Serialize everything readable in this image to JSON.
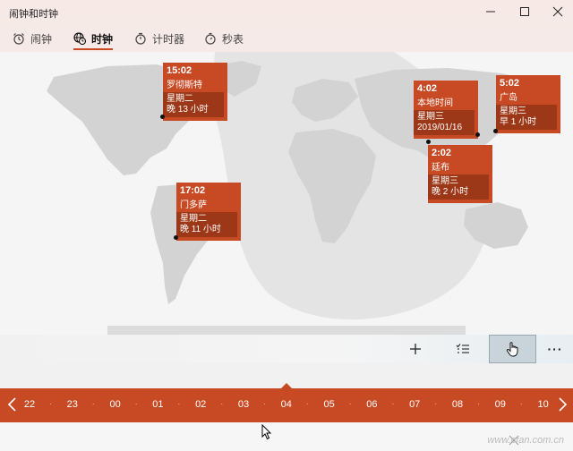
{
  "window": {
    "title": "闹钟和时钟"
  },
  "tabs": [
    {
      "label": "闹钟",
      "icon": "alarm-clock-icon"
    },
    {
      "label": "时钟",
      "icon": "globe-clock-icon",
      "active": true
    },
    {
      "label": "计时器",
      "icon": "timer-icon"
    },
    {
      "label": "秒表",
      "icon": "stopwatch-icon"
    }
  ],
  "clocks": [
    {
      "time": "15:02",
      "city": "罗彻斯特",
      "day": "星期二",
      "offset": "晚 13 小时"
    },
    {
      "time": "17:02",
      "city": "门多萨",
      "day": "星期二",
      "offset": "晚 11 小时"
    },
    {
      "time": "4:02",
      "city": "本地时间",
      "day": "星期三",
      "offset": "2019/01/16"
    },
    {
      "time": "2:02",
      "city": "廷布",
      "day": "星期三",
      "offset": "晚 2 小时"
    },
    {
      "time": "5:02",
      "city": "广岛",
      "day": "星期三",
      "offset": "早 1 小时"
    }
  ],
  "toolbar": {
    "add_icon": "plus-icon",
    "select_icon": "select-list-icon",
    "compare_icon": "hand-pointer-icon",
    "more_label": "···"
  },
  "timeline": {
    "hours": [
      "22",
      "23",
      "00",
      "01",
      "02",
      "03",
      "04",
      "05",
      "06",
      "07",
      "08",
      "09",
      "10"
    ],
    "current": "04"
  },
  "watermark": "www.cfan.com.cn",
  "colors": {
    "accent": "#c84a24",
    "accent_dark": "#9c3717",
    "land": "#d6d6d6",
    "night": "#e2e2e2"
  }
}
